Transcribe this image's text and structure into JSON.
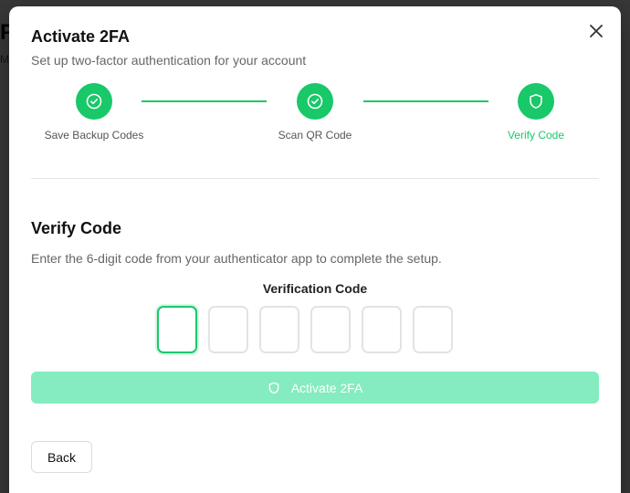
{
  "background": {
    "title": "P",
    "subtitle": "M"
  },
  "modal": {
    "title": "Activate 2FA",
    "subtitle": "Set up two-factor authentication for your account",
    "close_icon": "close-icon"
  },
  "stepper": {
    "steps": [
      {
        "label": "Save Backup Codes",
        "status": "completed",
        "icon": "check-circle-icon"
      },
      {
        "label": "Scan QR Code",
        "status": "completed",
        "icon": "check-circle-icon"
      },
      {
        "label": "Verify Code",
        "status": "active",
        "icon": "shield-icon"
      }
    ]
  },
  "verify": {
    "title": "Verify Code",
    "description": "Enter the 6-digit code from your authenticator app to complete the setup.",
    "code_label": "Verification Code",
    "code_digits": [
      "",
      "",
      "",
      "",
      "",
      ""
    ]
  },
  "actions": {
    "activate_label": "Activate 2FA",
    "activate_icon": "shield-icon",
    "activate_disabled": true,
    "back_label": "Back"
  },
  "colors": {
    "accent": "#18c869",
    "accent_disabled": "#84ecbe"
  }
}
